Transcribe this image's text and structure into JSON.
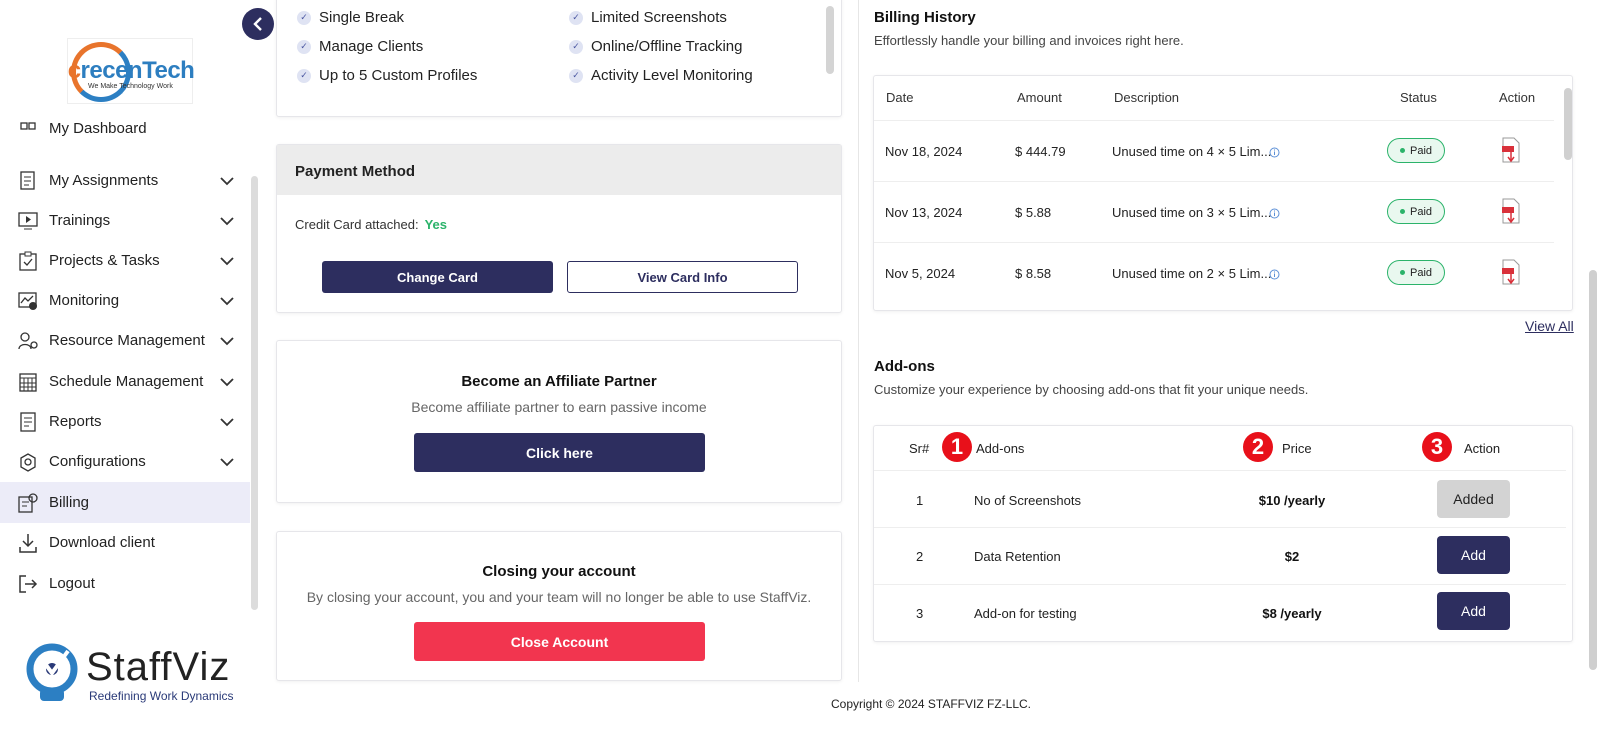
{
  "sidebar": {
    "logo_brand": "recenTech",
    "logo_brand_prefix": "c",
    "logo_tagline": "We Make Technology Work",
    "items": [
      {
        "label": "My Dashboard",
        "icon": "dashboard-icon",
        "has_chevron": false
      },
      {
        "label": "My Assignments",
        "icon": "assignments-icon",
        "has_chevron": true
      },
      {
        "label": "Trainings",
        "icon": "play-screen-icon",
        "has_chevron": true
      },
      {
        "label": "Projects & Tasks",
        "icon": "clipboard-icon",
        "has_chevron": true
      },
      {
        "label": "Monitoring",
        "icon": "monitor-chart-icon",
        "has_chevron": true
      },
      {
        "label": "Resource Management",
        "icon": "user-gear-icon",
        "has_chevron": true
      },
      {
        "label": "Schedule Management",
        "icon": "calendar-grid-icon",
        "has_chevron": true
      },
      {
        "label": "Reports",
        "icon": "report-icon",
        "has_chevron": true
      },
      {
        "label": "Configurations",
        "icon": "config-icon",
        "has_chevron": true
      },
      {
        "label": "Billing",
        "icon": "billing-icon",
        "has_chevron": false,
        "active": true
      },
      {
        "label": "Download client",
        "icon": "download-icon",
        "has_chevron": false
      },
      {
        "label": "Logout",
        "icon": "logout-icon",
        "has_chevron": false
      }
    ],
    "staffviz_name": "StaffViz",
    "staffviz_tagline": "Redefining Work Dynamics"
  },
  "plan": {
    "features_left": [
      "Single Break",
      "Manage Clients",
      "Up to 5 Custom Profiles"
    ],
    "features_right": [
      "Limited Screenshots",
      "Online/Offline Tracking",
      "Activity Level Monitoring"
    ]
  },
  "payment": {
    "title": "Payment Method",
    "card_label": "Credit Card attached:",
    "card_value": "Yes",
    "change_card": "Change Card",
    "view_card": "View Card Info"
  },
  "affiliate": {
    "title": "Become an Affiliate Partner",
    "subtitle": "Become affiliate partner to earn passive income",
    "button": "Click here"
  },
  "closing": {
    "title": "Closing your account",
    "subtitle": "By closing your account, you and your team will no longer be able to use StaffViz.",
    "button": "Close Account"
  },
  "billing": {
    "title": "Billing History",
    "subtitle": "Effortlessly handle your billing and invoices right here.",
    "headers": {
      "date": "Date",
      "amount": "Amount",
      "description": "Description",
      "status": "Status",
      "action": "Action"
    },
    "rows": [
      {
        "date": "Nov 18, 2024",
        "amount": "$ 444.79",
        "description": "Unused time on 4 × 5 Lim...",
        "status": "Paid"
      },
      {
        "date": "Nov 13, 2024",
        "amount": "$ 5.88",
        "description": "Unused time on 3 × 5 Lim...",
        "status": "Paid"
      },
      {
        "date": "Nov 5, 2024",
        "amount": "$ 8.58",
        "description": "Unused time on 2 × 5 Lim...",
        "status": "Paid"
      }
    ],
    "view_all": "View All"
  },
  "addons": {
    "title": "Add-ons",
    "subtitle": "Customize your experience by choosing add-ons that fit your unique needs.",
    "headers": {
      "sr": "Sr#",
      "name": "Add-ons",
      "price": "Price",
      "action": "Action"
    },
    "markers": [
      "1",
      "2",
      "3"
    ],
    "rows": [
      {
        "sr": "1",
        "name": "No of Screenshots",
        "price": "$10 /yearly",
        "action": "Added"
      },
      {
        "sr": "2",
        "name": "Data Retention",
        "price": "$2",
        "action": "Add"
      },
      {
        "sr": "3",
        "name": "Add-on for testing",
        "price": "$8 /yearly",
        "action": "Add"
      }
    ]
  },
  "footer": {
    "copyright": "Copyright © 2024 STAFFVIZ FZ-LLC."
  },
  "colors": {
    "primary": "#2d2e5f",
    "danger": "#f2354f",
    "success": "#2bb36a",
    "marker": "#e8101a"
  }
}
